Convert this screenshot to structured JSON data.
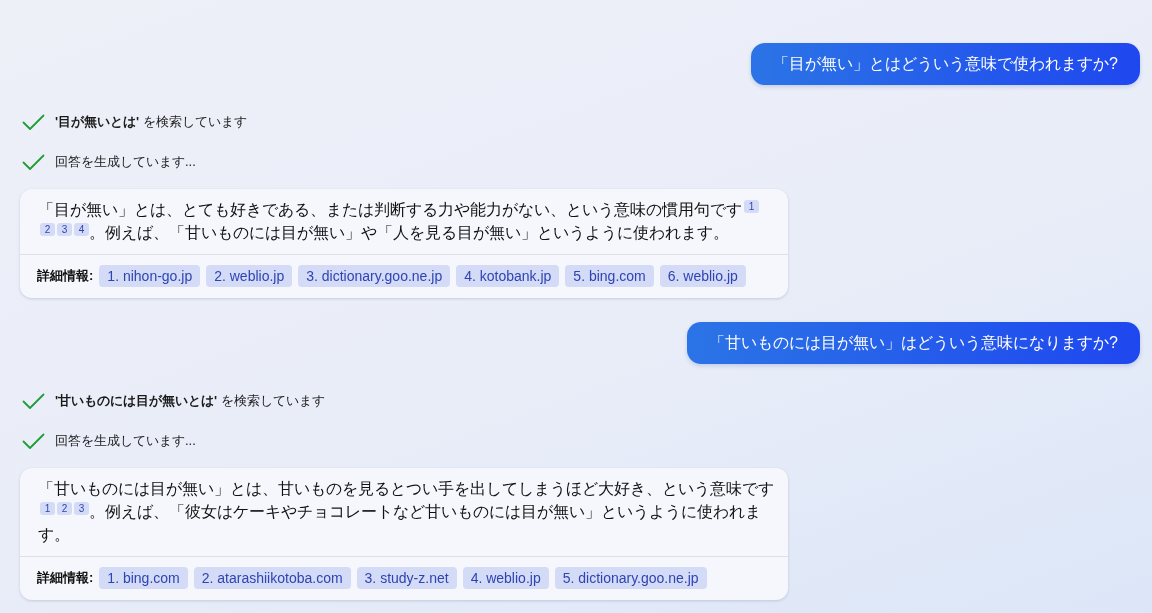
{
  "messages": [
    {
      "kind": "user",
      "text": "「目が無い」とはどういう意味で使われますか?"
    },
    {
      "kind": "status",
      "text": "**'目が無いとは'** を検索しています"
    },
    {
      "kind": "status",
      "text": "回答を生成しています..."
    },
    {
      "kind": "answer",
      "paragraph": [
        {
          "kind": "text",
          "text": "「目が無い」とは、とても好きである、または判断する力や能力がない、という意味の慣用句です"
        },
        {
          "kind": "citation",
          "text": "1"
        },
        {
          "kind": "citation",
          "text": "2"
        },
        {
          "kind": "citation",
          "text": "3"
        },
        {
          "kind": "citation",
          "text": "4"
        },
        {
          "kind": "text",
          "text": "。例えば、「甘いものには目が無い」や「人を見る目が無い」というように使われます。"
        }
      ],
      "sources_label": "詳細情報:",
      "sources": [
        "1. nihon-go.jp",
        "2. weblio.jp",
        "3. dictionary.goo.ne.jp",
        "4. kotobank.jp",
        "5. bing.com",
        "6. weblio.jp"
      ]
    },
    {
      "kind": "user",
      "text": "「甘いものには目が無い」はどういう意味になりますか?"
    },
    {
      "kind": "status",
      "text": "**'甘いものには目が無いとは'** を検索しています"
    },
    {
      "kind": "status",
      "text": "回答を生成しています..."
    },
    {
      "kind": "answer",
      "paragraph": [
        {
          "kind": "text",
          "text": "「甘いものには目が無い」とは、甘いものを見るとつい手を出してしまうほど大好き、という意味です"
        },
        {
          "kind": "citation",
          "text": "1"
        },
        {
          "kind": "citation",
          "text": "2"
        },
        {
          "kind": "citation",
          "text": "3"
        },
        {
          "kind": "text",
          "text": "。例えば、「彼女はケーキやチョコレートなど甘いものには目が無い」というように使われます。"
        }
      ],
      "sources_label": "詳細情報:",
      "sources": [
        "1. bing.com",
        "2. atarashiikotoba.com",
        "3. study-z.net",
        "4. weblio.jp",
        "5. dictionary.goo.ne.jp"
      ]
    }
  ]
}
